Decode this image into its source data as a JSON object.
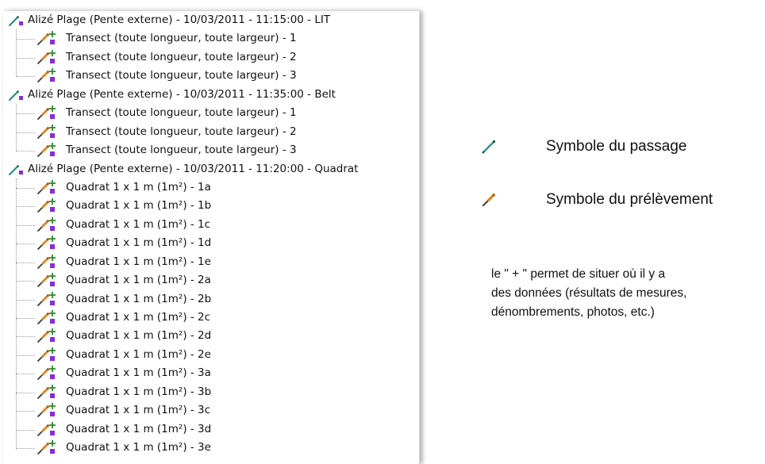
{
  "tree": {
    "groups": [
      {
        "label": "Alizé Plage (Pente externe) - 10/03/2011 - 11:15:00 - LIT",
        "icon": "passage-icon",
        "children": [
          "Transect (toute longueur, toute largeur) - 1",
          "Transect (toute longueur, toute largeur) - 2",
          "Transect (toute longueur, toute largeur) - 3"
        ]
      },
      {
        "label": "Alizé Plage (Pente externe) - 10/03/2011 - 11:35:00 - Belt",
        "icon": "passage-icon",
        "children": [
          "Transect (toute longueur, toute largeur) - 1",
          "Transect (toute longueur, toute largeur) - 2",
          "Transect (toute longueur, toute largeur) - 3"
        ]
      },
      {
        "label": "Alizé Plage (Pente externe) - 10/03/2011 - 11:20:00 - Quadrat",
        "icon": "passage-icon",
        "children": [
          "Quadrat 1 x 1 m (1m²) - 1a",
          "Quadrat 1 x 1 m (1m²) - 1b",
          "Quadrat 1 x 1 m (1m²) - 1c",
          "Quadrat 1 x 1 m (1m²) - 1d",
          "Quadrat 1 x 1 m (1m²) - 1e",
          "Quadrat 1 x 1 m (1m²) - 2a",
          "Quadrat 1 x 1 m (1m²) - 2b",
          "Quadrat 1 x 1 m (1m²) - 2c",
          "Quadrat 1 x 1 m (1m²) - 2d",
          "Quadrat 1 x 1 m (1m²) - 2e",
          "Quadrat 1 x 1 m (1m²) - 3a",
          "Quadrat 1 x 1 m (1m²) - 3b",
          "Quadrat 1 x 1 m (1m²) - 3c",
          "Quadrat 1 x 1 m (1m²) - 3d",
          "Quadrat 1 x 1 m (1m²) - 3e"
        ]
      }
    ],
    "child_icon": "prelevement-plus-icon"
  },
  "legend": {
    "passage_label": "Symbole du passage",
    "prelevement_label": "Symbole du prélèvement",
    "note_lines": [
      "le \" + \" permet de situer où il y a",
      "des données (résultats de mesures,",
      "dénombrements, photos, etc.)"
    ]
  },
  "colors": {
    "passage_teal": "#1f8a86",
    "prelevement_orange": "#d9892c",
    "prelevement_dark": "#3a3a3a",
    "marker_purple": "#8a2be2",
    "plus_green": "#2e8b2e"
  }
}
